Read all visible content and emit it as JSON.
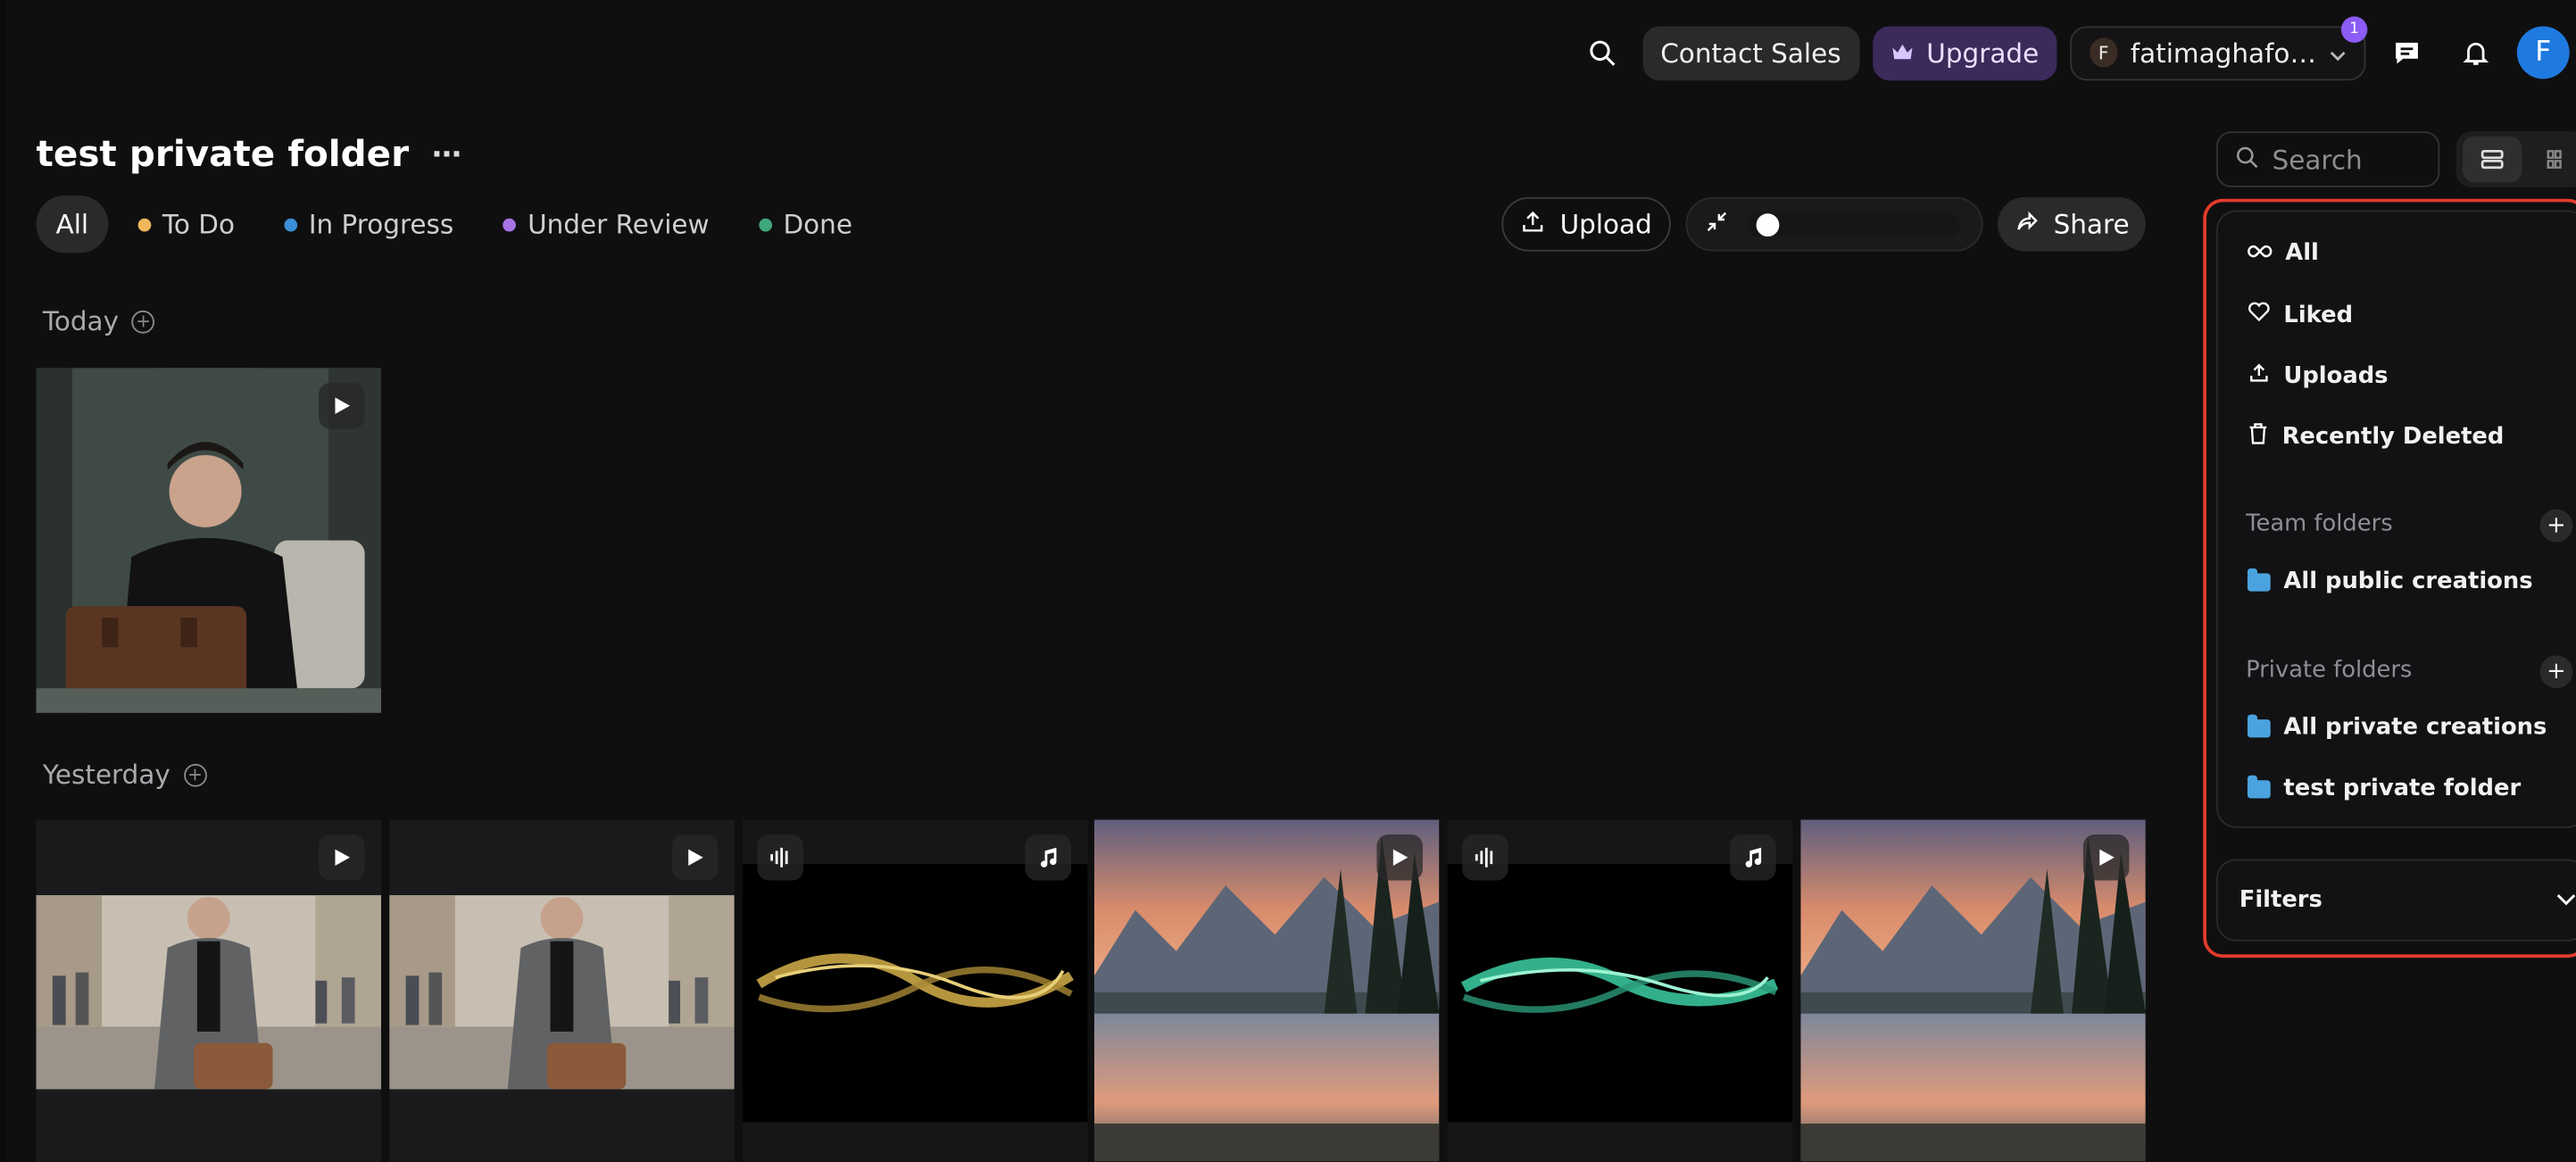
{
  "topbar": {
    "contact_label": "Contact Sales",
    "upgrade_label": "Upgrade",
    "account_initial": "F",
    "account_name": "fatimaghafoo...",
    "notification_count": "1",
    "avatar_initial": "F",
    "icons": [
      "search-icon",
      "crown-icon",
      "chevron-down-icon",
      "message-icon",
      "bell-icon"
    ]
  },
  "page": {
    "title": "test private folder",
    "more_label": "⋯"
  },
  "tabs": [
    {
      "label": "All",
      "color": ""
    },
    {
      "label": "To Do",
      "color": "#f1b75b"
    },
    {
      "label": "In Progress",
      "color": "#3b8fd6"
    },
    {
      "label": "Under Review",
      "color": "#a774e8"
    },
    {
      "label": "Done",
      "color": "#3fa77a"
    }
  ],
  "controls": {
    "upload_label": "Upload",
    "share_label": "Share",
    "zoom_level": 0.05
  },
  "sections": [
    {
      "label": "Today"
    },
    {
      "label": "Yesterday"
    }
  ],
  "sidebar": {
    "search_placeholder": "Search",
    "nav": [
      {
        "label": "All",
        "icon": "infinity-icon"
      },
      {
        "label": "Liked",
        "icon": "heart-icon"
      },
      {
        "label": "Uploads",
        "icon": "upload-icon"
      },
      {
        "label": "Recently Deleted",
        "icon": "trash-icon"
      }
    ],
    "team_folders_label": "Team folders",
    "team_folders": [
      {
        "label": "All public creations"
      }
    ],
    "private_folders_label": "Private folders",
    "private_folders": [
      {
        "label": "All private creations"
      },
      {
        "label": "test private folder"
      }
    ],
    "filters_label": "Filters"
  },
  "colors": {
    "accent_blue": "#1f7ae0",
    "upgrade_purple": "#3b2a5a",
    "highlight_red": "#e53b2c"
  }
}
